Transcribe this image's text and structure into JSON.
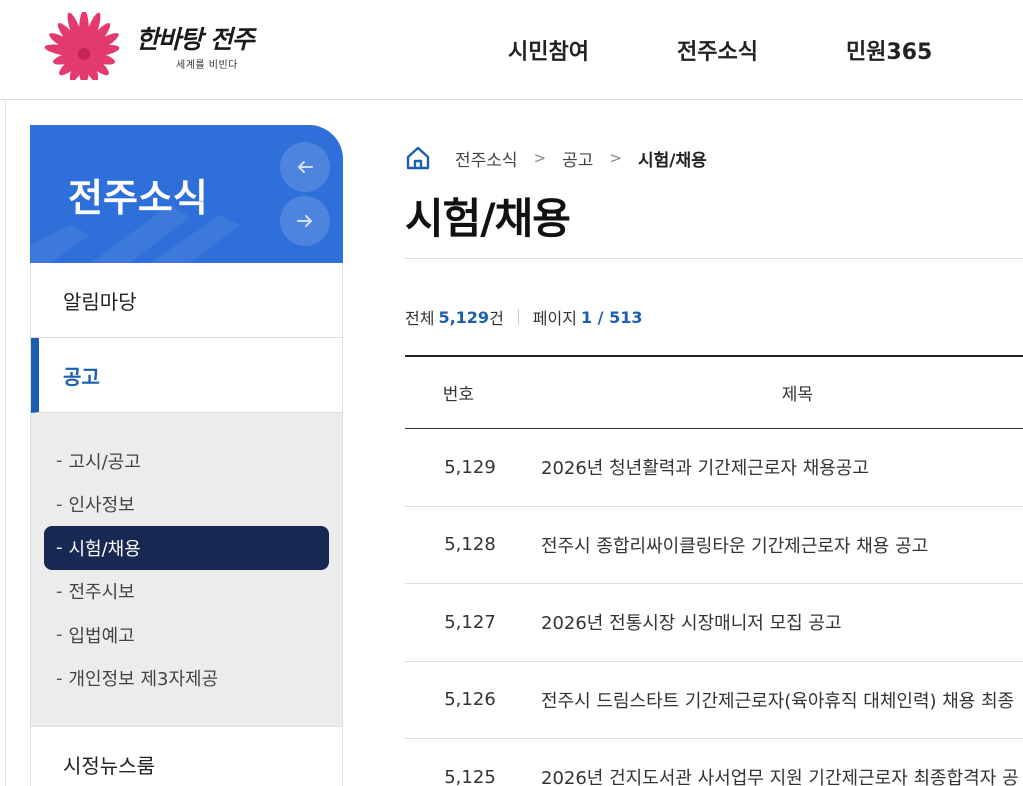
{
  "header": {
    "logo_text": "한바탕 전주",
    "logo_sub": "세계를 비빈다",
    "nav": [
      "시민참여",
      "전주소식",
      "민원365"
    ]
  },
  "sidebar": {
    "title": "전주소식",
    "prev_icon": "arrow-left-icon",
    "next_icon": "arrow-right-icon",
    "menu": [
      {
        "label": "알림마당",
        "active": false
      },
      {
        "label": "공고",
        "active": true
      }
    ],
    "sub_menu": [
      "고시/공고",
      "인사정보",
      "시험/채용",
      "전주시보",
      "입법예고",
      "개인정보 제3자제공"
    ],
    "sub_current": "시험/채용",
    "menu_after": "시정뉴스룸"
  },
  "breadcrumb": {
    "home_icon": "home-icon",
    "items": [
      "전주소식",
      "공고",
      "시험/채용"
    ]
  },
  "page_title": "시험/채용",
  "summary": {
    "total_label": "전체",
    "total_value": "5,129",
    "total_unit": "건",
    "page_label": "페이지",
    "page_value": "1 / 513"
  },
  "table": {
    "headers": [
      "번호",
      "제목"
    ],
    "rows": [
      {
        "num": "5,129",
        "title": "2026년 청년활력과 기간제근로자 채용공고"
      },
      {
        "num": "5,128",
        "title": "전주시 종합리싸이클링타운 기간제근로자 채용 공고"
      },
      {
        "num": "5,127",
        "title": "2026년 전통시장 시장매니저 모집 공고"
      },
      {
        "num": "5,126",
        "title": "전주시 드림스타트 기간제근로자(육아휴직 대체인력) 채용 최종"
      },
      {
        "num": "5,125",
        "title": "2026년 건지도서관 사서업무 지원 기간제근로자 최종합격자 공"
      }
    ]
  },
  "colors": {
    "primary_blue": "#2e6fd9",
    "active_blue": "#1b5fb0",
    "current_sub_bg": "#172852"
  }
}
